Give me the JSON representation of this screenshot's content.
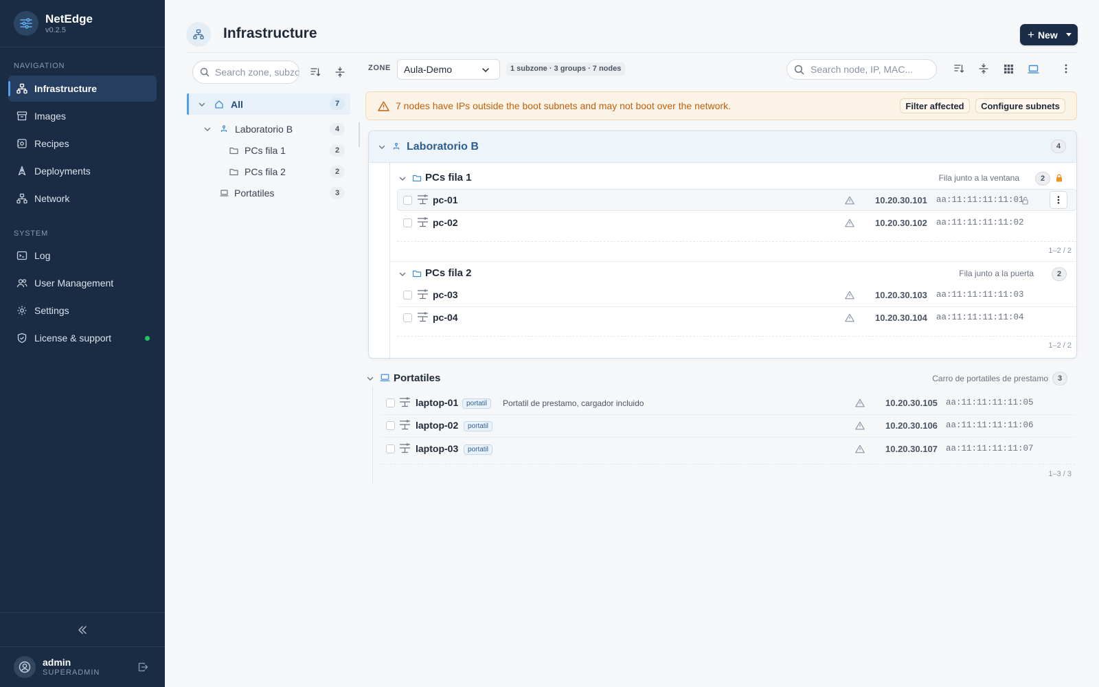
{
  "app": {
    "name": "NetEdge",
    "version": "v0.2.5"
  },
  "sidebar": {
    "nav_section": "NAVIGATION",
    "system_section": "SYSTEM",
    "nav_items": [
      {
        "label": "Infrastructure",
        "icon": "network-nodes-icon",
        "active": true
      },
      {
        "label": "Images",
        "icon": "archive-icon"
      },
      {
        "label": "Recipes",
        "icon": "recipe-icon"
      },
      {
        "label": "Deployments",
        "icon": "rocket-icon"
      },
      {
        "label": "Network",
        "icon": "network-icon"
      }
    ],
    "system_items": [
      {
        "label": "Log",
        "icon": "terminal-icon"
      },
      {
        "label": "User Management",
        "icon": "users-icon"
      },
      {
        "label": "Settings",
        "icon": "gear-icon"
      },
      {
        "label": "License & support",
        "icon": "shield-icon",
        "status_color": "#22c55e"
      }
    ],
    "user": {
      "name": "admin",
      "role": "SUPERADMIN"
    }
  },
  "header": {
    "title": "Infrastructure",
    "new_button": "New"
  },
  "tree": {
    "search_placeholder": "Search zone, subzone, group…",
    "items": [
      {
        "label": "All",
        "count": "7"
      },
      {
        "label": "Laboratorio B",
        "count": "4"
      },
      {
        "label": "PCs fila 1",
        "count": "2"
      },
      {
        "label": "PCs fila 2",
        "count": "2"
      },
      {
        "label": "Portatiles",
        "count": "3"
      }
    ]
  },
  "toolbar": {
    "zone_label": "ZONE",
    "zone_value": "Aula-Demo",
    "summary": "1 subzone · 3 groups · 7 nodes",
    "search_placeholder": "Search node, IP, MAC..."
  },
  "warning": {
    "text": "7 nodes have IPs outside the boot subnets and may not boot over the network.",
    "filter_button": "Filter affected",
    "configure_button": "Configure subnets",
    "color": "#c2610c"
  },
  "subzone": {
    "title": "Laboratorio B",
    "count": "4",
    "groups": [
      {
        "title": "PCs fila 1",
        "description": "Fila junto a la ventana",
        "count": "2",
        "pager": "1–2 / 2",
        "nodes": [
          {
            "name": "pc-01",
            "ip": "10.20.30.101",
            "mac": "aa:11:11:11:11:01"
          },
          {
            "name": "pc-02",
            "ip": "10.20.30.102",
            "mac": "aa:11:11:11:11:02"
          }
        ]
      },
      {
        "title": "PCs fila 2",
        "description": "Fila junto a la puerta",
        "count": "2",
        "pager": "1–2 / 2",
        "nodes": [
          {
            "name": "pc-03",
            "ip": "10.20.30.103",
            "mac": "aa:11:11:11:11:03"
          },
          {
            "name": "pc-04",
            "ip": "10.20.30.104",
            "mac": "aa:11:11:11:11:04"
          }
        ]
      }
    ]
  },
  "standalone_group": {
    "title": "Portatiles",
    "description": "Carro de portatiles de prestamo",
    "count": "3",
    "pager": "1–3 / 3",
    "nodes": [
      {
        "name": "laptop-01",
        "tag": "portatil",
        "note": "Portatil de prestamo, cargador incluido",
        "ip": "10.20.30.105",
        "mac": "aa:11:11:11:11:05"
      },
      {
        "name": "laptop-02",
        "tag": "portatil",
        "ip": "10.20.30.106",
        "mac": "aa:11:11:11:11:06"
      },
      {
        "name": "laptop-03",
        "tag": "portatil",
        "ip": "10.20.30.107",
        "mac": "aa:11:11:11:11:07"
      }
    ]
  }
}
